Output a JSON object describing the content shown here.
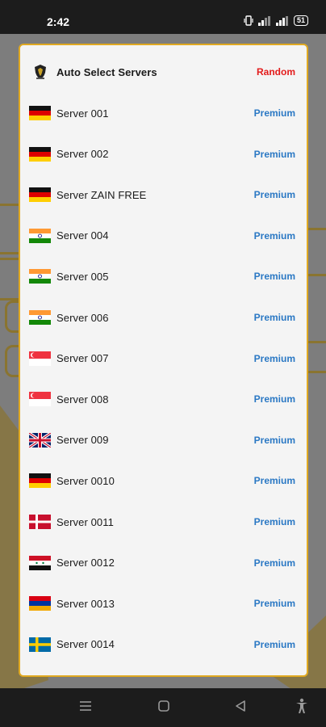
{
  "status_bar": {
    "time": "2:42",
    "battery": "51"
  },
  "dialog": {
    "auto_row": {
      "label": "Auto Select Servers",
      "tag": "Random",
      "icon": "shield-logo-icon"
    },
    "servers": [
      {
        "name": "Server 001",
        "tag": "Premium",
        "flag": "germany"
      },
      {
        "name": "Server 002",
        "tag": "Premium",
        "flag": "germany"
      },
      {
        "name": "Server ZAIN FREE",
        "tag": "Premium",
        "flag": "germany"
      },
      {
        "name": "Server 004",
        "tag": "Premium",
        "flag": "india"
      },
      {
        "name": "Server 005",
        "tag": "Premium",
        "flag": "india"
      },
      {
        "name": "Server 006",
        "tag": "Premium",
        "flag": "india"
      },
      {
        "name": "Server 007",
        "tag": "Premium",
        "flag": "singapore"
      },
      {
        "name": "Server 008",
        "tag": "Premium",
        "flag": "singapore"
      },
      {
        "name": "Server 009",
        "tag": "Premium",
        "flag": "united-kingdom"
      },
      {
        "name": "Server 0010",
        "tag": "Premium",
        "flag": "germany"
      },
      {
        "name": "Server 0011",
        "tag": "Premium",
        "flag": "denmark"
      },
      {
        "name": "Server 0012",
        "tag": "Premium",
        "flag": "syria"
      },
      {
        "name": "Server 0013",
        "tag": "Premium",
        "flag": "armenia"
      },
      {
        "name": "Server 0014",
        "tag": "Premium",
        "flag": "sweden"
      }
    ]
  },
  "colors": {
    "premium": "#2a78c4",
    "random": "#e31b1b",
    "dialog_border": "#e0a921"
  }
}
